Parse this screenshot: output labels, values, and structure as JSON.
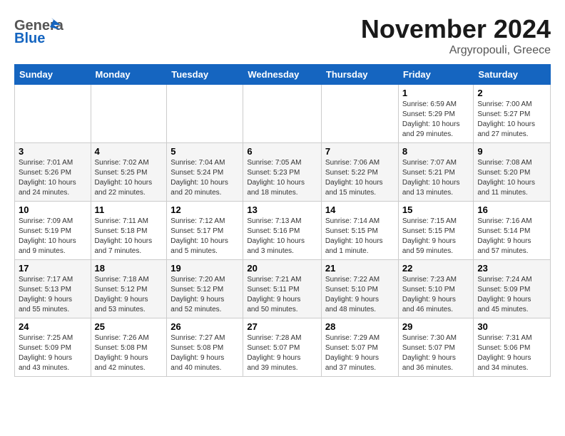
{
  "header": {
    "logo_general": "General",
    "logo_blue": "Blue",
    "month_title": "November 2024",
    "subtitle": "Argyropouli, Greece"
  },
  "calendar": {
    "weekdays": [
      "Sunday",
      "Monday",
      "Tuesday",
      "Wednesday",
      "Thursday",
      "Friday",
      "Saturday"
    ],
    "weeks": [
      [
        {
          "day": "",
          "info": ""
        },
        {
          "day": "",
          "info": ""
        },
        {
          "day": "",
          "info": ""
        },
        {
          "day": "",
          "info": ""
        },
        {
          "day": "",
          "info": ""
        },
        {
          "day": "1",
          "info": "Sunrise: 6:59 AM\nSunset: 5:29 PM\nDaylight: 10 hours\nand 29 minutes."
        },
        {
          "day": "2",
          "info": "Sunrise: 7:00 AM\nSunset: 5:27 PM\nDaylight: 10 hours\nand 27 minutes."
        }
      ],
      [
        {
          "day": "3",
          "info": "Sunrise: 7:01 AM\nSunset: 5:26 PM\nDaylight: 10 hours\nand 24 minutes."
        },
        {
          "day": "4",
          "info": "Sunrise: 7:02 AM\nSunset: 5:25 PM\nDaylight: 10 hours\nand 22 minutes."
        },
        {
          "day": "5",
          "info": "Sunrise: 7:04 AM\nSunset: 5:24 PM\nDaylight: 10 hours\nand 20 minutes."
        },
        {
          "day": "6",
          "info": "Sunrise: 7:05 AM\nSunset: 5:23 PM\nDaylight: 10 hours\nand 18 minutes."
        },
        {
          "day": "7",
          "info": "Sunrise: 7:06 AM\nSunset: 5:22 PM\nDaylight: 10 hours\nand 15 minutes."
        },
        {
          "day": "8",
          "info": "Sunrise: 7:07 AM\nSunset: 5:21 PM\nDaylight: 10 hours\nand 13 minutes."
        },
        {
          "day": "9",
          "info": "Sunrise: 7:08 AM\nSunset: 5:20 PM\nDaylight: 10 hours\nand 11 minutes."
        }
      ],
      [
        {
          "day": "10",
          "info": "Sunrise: 7:09 AM\nSunset: 5:19 PM\nDaylight: 10 hours\nand 9 minutes."
        },
        {
          "day": "11",
          "info": "Sunrise: 7:11 AM\nSunset: 5:18 PM\nDaylight: 10 hours\nand 7 minutes."
        },
        {
          "day": "12",
          "info": "Sunrise: 7:12 AM\nSunset: 5:17 PM\nDaylight: 10 hours\nand 5 minutes."
        },
        {
          "day": "13",
          "info": "Sunrise: 7:13 AM\nSunset: 5:16 PM\nDaylight: 10 hours\nand 3 minutes."
        },
        {
          "day": "14",
          "info": "Sunrise: 7:14 AM\nSunset: 5:15 PM\nDaylight: 10 hours\nand 1 minute."
        },
        {
          "day": "15",
          "info": "Sunrise: 7:15 AM\nSunset: 5:15 PM\nDaylight: 9 hours\nand 59 minutes."
        },
        {
          "day": "16",
          "info": "Sunrise: 7:16 AM\nSunset: 5:14 PM\nDaylight: 9 hours\nand 57 minutes."
        }
      ],
      [
        {
          "day": "17",
          "info": "Sunrise: 7:17 AM\nSunset: 5:13 PM\nDaylight: 9 hours\nand 55 minutes."
        },
        {
          "day": "18",
          "info": "Sunrise: 7:18 AM\nSunset: 5:12 PM\nDaylight: 9 hours\nand 53 minutes."
        },
        {
          "day": "19",
          "info": "Sunrise: 7:20 AM\nSunset: 5:12 PM\nDaylight: 9 hours\nand 52 minutes."
        },
        {
          "day": "20",
          "info": "Sunrise: 7:21 AM\nSunset: 5:11 PM\nDaylight: 9 hours\nand 50 minutes."
        },
        {
          "day": "21",
          "info": "Sunrise: 7:22 AM\nSunset: 5:10 PM\nDaylight: 9 hours\nand 48 minutes."
        },
        {
          "day": "22",
          "info": "Sunrise: 7:23 AM\nSunset: 5:10 PM\nDaylight: 9 hours\nand 46 minutes."
        },
        {
          "day": "23",
          "info": "Sunrise: 7:24 AM\nSunset: 5:09 PM\nDaylight: 9 hours\nand 45 minutes."
        }
      ],
      [
        {
          "day": "24",
          "info": "Sunrise: 7:25 AM\nSunset: 5:09 PM\nDaylight: 9 hours\nand 43 minutes."
        },
        {
          "day": "25",
          "info": "Sunrise: 7:26 AM\nSunset: 5:08 PM\nDaylight: 9 hours\nand 42 minutes."
        },
        {
          "day": "26",
          "info": "Sunrise: 7:27 AM\nSunset: 5:08 PM\nDaylight: 9 hours\nand 40 minutes."
        },
        {
          "day": "27",
          "info": "Sunrise: 7:28 AM\nSunset: 5:07 PM\nDaylight: 9 hours\nand 39 minutes."
        },
        {
          "day": "28",
          "info": "Sunrise: 7:29 AM\nSunset: 5:07 PM\nDaylight: 9 hours\nand 37 minutes."
        },
        {
          "day": "29",
          "info": "Sunrise: 7:30 AM\nSunset: 5:07 PM\nDaylight: 9 hours\nand 36 minutes."
        },
        {
          "day": "30",
          "info": "Sunrise: 7:31 AM\nSunset: 5:06 PM\nDaylight: 9 hours\nand 34 minutes."
        }
      ]
    ]
  }
}
